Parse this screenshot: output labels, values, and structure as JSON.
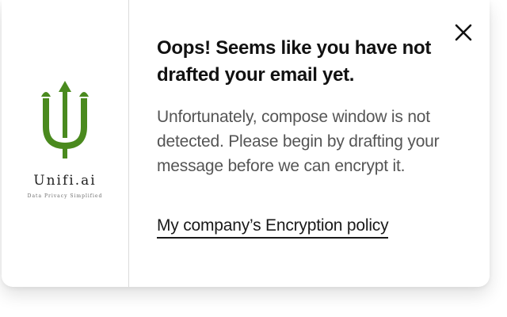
{
  "brand": {
    "name": "Unifi.ai",
    "tagline": "Data Privacy Simplified",
    "logo_icon": "unifi-trident-logo",
    "logo_color": "#4a8a1e"
  },
  "dialog": {
    "close_icon": "close-icon",
    "heading": "Oops! Seems like you have not drafted your email yet.",
    "message": "Unfortunately, compose window is not detected. Please begin by drafting your message before we can encrypt it.",
    "policy_link": "My company’s Encryption policy"
  }
}
